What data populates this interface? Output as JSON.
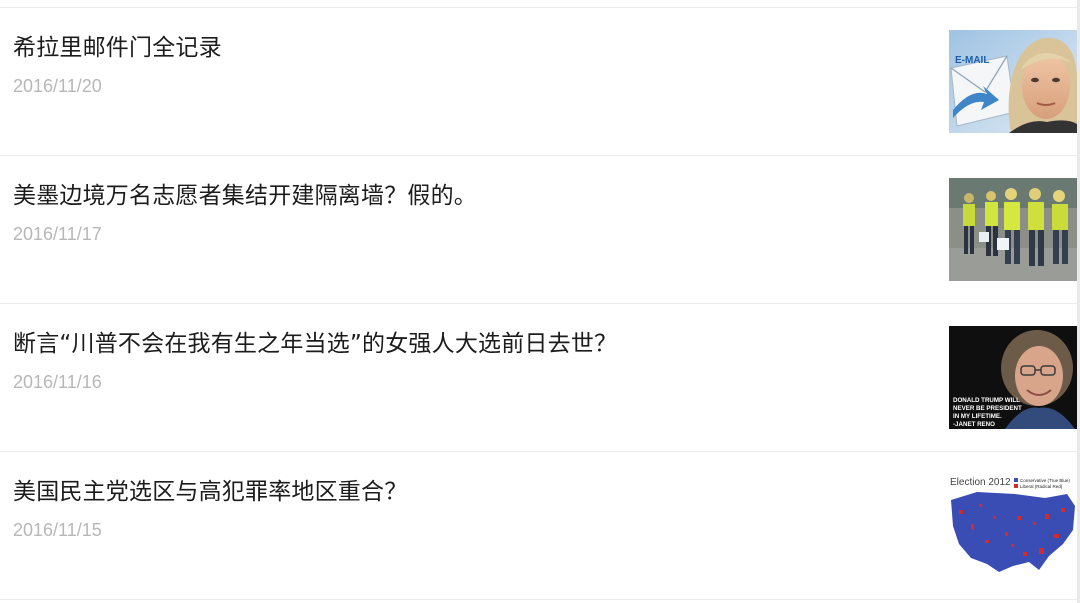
{
  "articles": [
    {
      "title": "希拉里邮件门全记录",
      "date": "2016/11/20",
      "thumbnail": {
        "text": "E-MAIL"
      }
    },
    {
      "title": "美墨边境万名志愿者集结开建隔离墙？假的。",
      "date": "2016/11/17"
    },
    {
      "title": "断言“川普不会在我有生之年当选”的女强人大选前日去世？",
      "date": "2016/11/16",
      "thumbnail": {
        "lines": [
          "DONALD TRUMP WILL",
          "NEVER BE PRESIDENT",
          "IN MY LIFETIME.",
          "-JANET RENO"
        ]
      }
    },
    {
      "title": "美国民主党选区与高犯罪率地区重合？",
      "date": "2016/11/15",
      "thumbnail": {
        "heading": "Election 2012",
        "legend": [
          "Conservative (True Blue)",
          "Liberal (Radical Red)"
        ]
      }
    }
  ],
  "colors": {
    "title": "#1c1c1c",
    "date": "#b7b7b7",
    "divider": "#ececec"
  }
}
